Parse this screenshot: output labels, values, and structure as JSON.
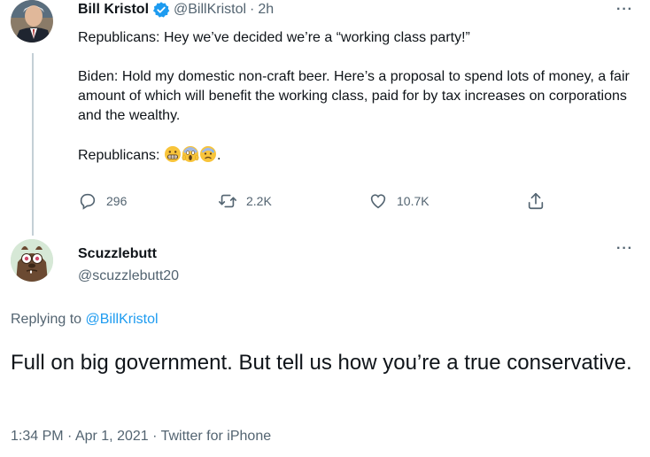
{
  "tweet": {
    "author_name": "Bill Kristol",
    "handle": "@BillKristol",
    "separator": "·",
    "time": "2h",
    "line1": "Republicans: Hey we’ve decided we’re a “working class party!”",
    "line2": "Biden: Hold my domestic non-craft beer. Here’s a proposal to spend lots of money, a fair amount of which will benefit the working class, paid for by tax increases on corporations and the wealthy.",
    "line3_prefix": "Republicans:",
    "line3_suffix": ".",
    "emojis": [
      "grimacing-face",
      "screaming-face",
      "anxious-face"
    ],
    "replies": "296",
    "retweets": "2.2K",
    "likes": "10.7K",
    "more": "···",
    "verified": true
  },
  "reply": {
    "author_name": "Scuzzlebutt",
    "handle": "@scuzzlebutt20",
    "more": "···",
    "replying_prefix": "Replying to",
    "replying_handle": "@BillKristol",
    "text": "Full on big government.  But tell us how you’re a true conservative.",
    "time": "1:34 PM",
    "date": "Apr 1, 2021",
    "source": "Twitter for iPhone",
    "sep": "·"
  },
  "colors": {
    "link": "#1d9bf0",
    "muted": "#536471",
    "text": "#0f1419",
    "line": "#c4cfd6"
  }
}
